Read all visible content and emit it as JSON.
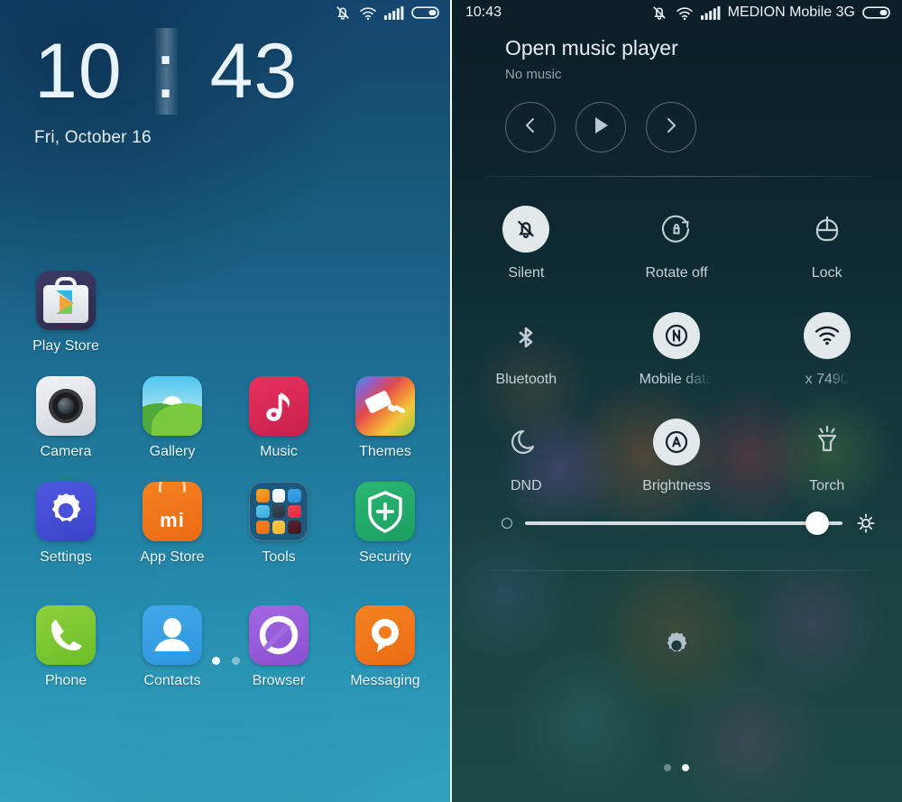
{
  "home": {
    "statusbar": {
      "icons": [
        "silent-bell-icon",
        "wifi-icon",
        "signal-icon",
        "battery-icon"
      ]
    },
    "clock": {
      "hours": "10",
      "separator": ":",
      "minutes": "43"
    },
    "date": "Fri, October 16",
    "rows": [
      [
        {
          "label": "Play Store",
          "icon": "play-store-icon"
        }
      ],
      [
        {
          "label": "Camera",
          "icon": "camera-icon"
        },
        {
          "label": "Gallery",
          "icon": "gallery-icon"
        },
        {
          "label": "Music",
          "icon": "music-icon"
        },
        {
          "label": "Themes",
          "icon": "themes-icon"
        }
      ],
      [
        {
          "label": "Settings",
          "icon": "settings-icon"
        },
        {
          "label": "App Store",
          "icon": "app-store-icon"
        },
        {
          "label": "Tools",
          "icon": "tools-folder-icon"
        },
        {
          "label": "Security",
          "icon": "security-icon"
        }
      ],
      [
        {
          "label": "Phone",
          "icon": "phone-icon"
        },
        {
          "label": "Contacts",
          "icon": "contacts-icon"
        },
        {
          "label": "Browser",
          "icon": "browser-icon"
        },
        {
          "label": "Messaging",
          "icon": "messaging-icon"
        }
      ]
    ],
    "page_dots": {
      "count": 2,
      "active_index": 0
    }
  },
  "control_center": {
    "statusbar": {
      "time": "10:43",
      "carrier": "MEDION Mobile 3G",
      "icons": [
        "silent-bell-icon",
        "wifi-icon",
        "signal-icon",
        "battery-icon"
      ]
    },
    "music": {
      "title": "Open music player",
      "subtitle": "No music",
      "buttons": [
        {
          "name": "previous-track-button",
          "icon": "chevron-left-icon"
        },
        {
          "name": "play-button",
          "icon": "play-icon"
        },
        {
          "name": "next-track-button",
          "icon": "chevron-right-icon"
        }
      ]
    },
    "toggles": [
      [
        {
          "label": "Silent",
          "icon": "bell-off-icon",
          "active": true
        },
        {
          "label": "Rotate off",
          "icon": "rotate-lock-icon",
          "active": false
        },
        {
          "label": "Lock",
          "icon": "lock-icon",
          "active": false
        }
      ],
      [
        {
          "label": "Bluetooth",
          "icon": "bluetooth-icon",
          "active": false
        },
        {
          "label": "Mobile data",
          "icon": "mobile-data-icon",
          "active": true
        },
        {
          "label": "x 7490",
          "icon": "wifi-icon",
          "active": true
        }
      ],
      [
        {
          "label": "DND",
          "icon": "moon-icon",
          "active": false
        },
        {
          "label": "Brightness",
          "icon": "auto-brightness-icon",
          "active": true
        },
        {
          "label": "Torch",
          "icon": "torch-icon",
          "active": false
        }
      ]
    ],
    "brightness_slider": {
      "min_icon": "small-sun-icon",
      "max_icon": "sun-icon",
      "value_percent": 92
    },
    "settings_shortcut": {
      "icon": "gear-icon"
    },
    "page_dots": {
      "count": 2,
      "active_index": 1
    }
  },
  "colors": {
    "home_top": "#14456e",
    "home_bottom": "#31a6c0",
    "cc_top": "#0c1e28",
    "cc_bottom": "#1d4a44",
    "accent_white": "#e3e8ea"
  }
}
